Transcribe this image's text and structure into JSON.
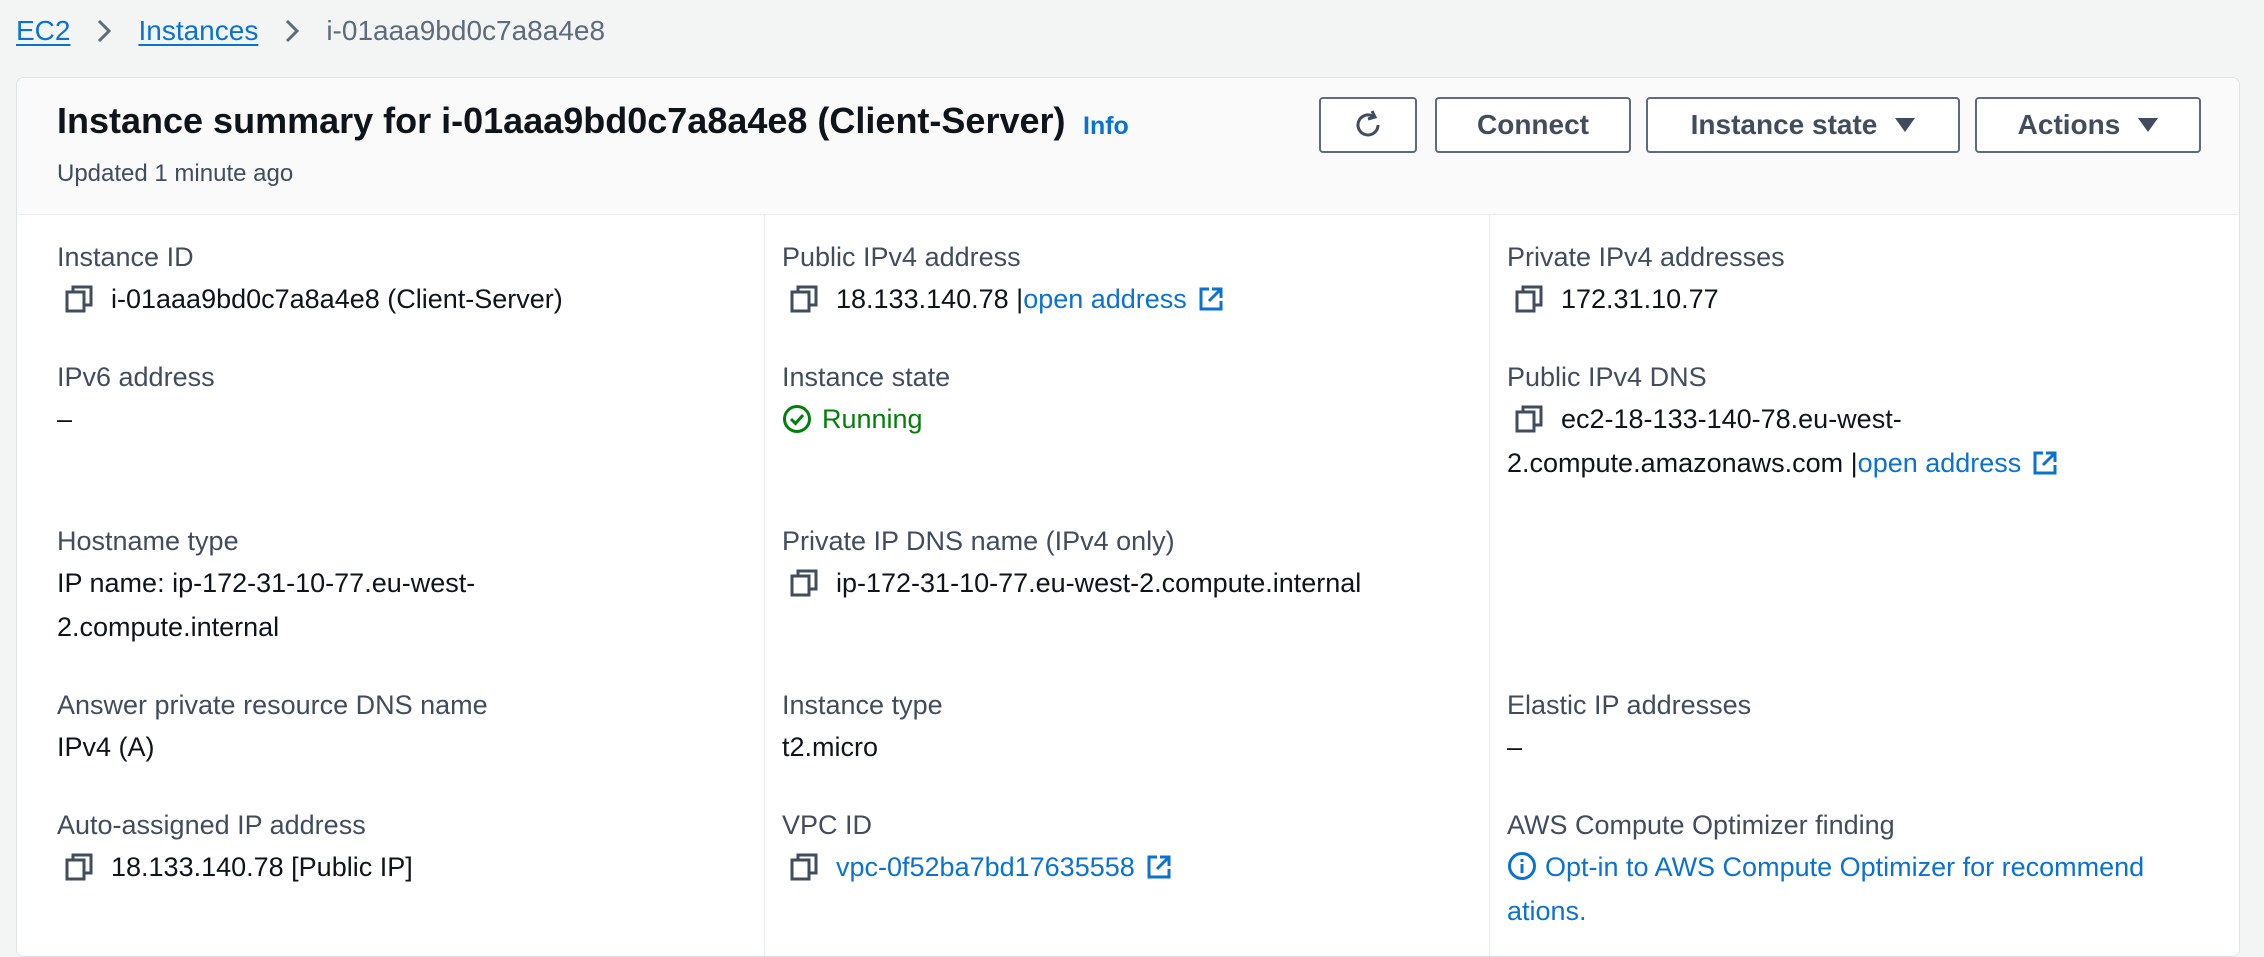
{
  "breadcrumb": {
    "items": [
      "EC2",
      "Instances"
    ],
    "current": "i-01aaa9bd0c7a8a4e8"
  },
  "header": {
    "title": "Instance summary for i-01aaa9bd0c7a8a4e8 (Client-Server)",
    "info": "Info",
    "updated": "Updated 1 minute ago",
    "buttons": {
      "refresh_icon": "refresh-icon",
      "connect": "Connect",
      "instance_state": "Instance state",
      "actions": "Actions"
    }
  },
  "fields": {
    "instance_id": {
      "label": "Instance ID",
      "value": "i-01aaa9bd0c7a8a4e8 (Client-Server)"
    },
    "public_ipv4": {
      "label": "Public IPv4 address",
      "value": "18.133.140.78 |",
      "link": "open address"
    },
    "private_ipv4": {
      "label": "Private IPv4 addresses",
      "value": "172.31.10.77"
    },
    "ipv6": {
      "label": "IPv6 address",
      "value": "–"
    },
    "instance_state": {
      "label": "Instance state",
      "value": "Running"
    },
    "public_dns": {
      "label": "Public IPv4 DNS",
      "value_line1": "ec2-18-133-140-78.eu-west-",
      "value_line2": "2.compute.amazonaws.com |",
      "link": "open address"
    },
    "hostname_type": {
      "label": "Hostname type",
      "value_line1": "IP name: ip-172-31-10-77.eu-west-",
      "value_line2": "2.compute.internal"
    },
    "private_dns": {
      "label": "Private IP DNS name (IPv4 only)",
      "value": "ip-172-31-10-77.eu-west-2.compute.internal"
    },
    "answer_dns": {
      "label": "Answer private resource DNS name",
      "value": "IPv4 (A)"
    },
    "instance_type": {
      "label": "Instance type",
      "value": "t2.micro"
    },
    "elastic_ip": {
      "label": "Elastic IP addresses",
      "value": "–"
    },
    "auto_ip": {
      "label": "Auto-assigned IP address",
      "value": "18.133.140.78 [Public IP]"
    },
    "vpc_id": {
      "label": "VPC ID",
      "value": "vpc-0f52ba7bd17635558"
    },
    "optimizer": {
      "label": "AWS Compute Optimizer finding",
      "value_line1": "Opt-in to AWS Compute Optimizer for recommend",
      "value_line2": "ations."
    }
  },
  "colors": {
    "link": "#0972d3",
    "running": "#037f0c",
    "label": "#414d5c"
  }
}
